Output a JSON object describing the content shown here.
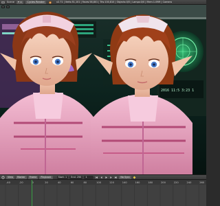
{
  "top_bar": {
    "editor_menu": "Scene",
    "render_engine": "Cycles Render",
    "stats": "v2.71 | Verts:51,101 | Faces:58,801 | Tris:100,810 | Objects:0/5 | Lamps:0/0 | Mem:1.09M | Camera"
  },
  "viewport": {
    "background_color": "#0d241f",
    "characters": [
      {
        "hair_color": "#9a3f1e",
        "suit_color": "#e8a4c0",
        "eye_color": "#4a7bc8",
        "ribbon_color": "#a46aca"
      },
      {
        "hair_color": "#a0401a",
        "suit_color": "#e8a4c0",
        "eye_color": "#4a7bc8",
        "ribbon_color": "#f0e4ec"
      }
    ],
    "console_readout": "2016 11:5 3:23 1"
  },
  "timeline_header": {
    "view_label": "View",
    "marker_label": "Marker",
    "frame_label": "Frame",
    "playback_label": "Playback",
    "start": "Start: 1",
    "end": "End: 250",
    "current_frame": "1",
    "sync": "No Sync"
  },
  "timeline": {
    "ticks": [
      "-40",
      "-20",
      "0",
      "20",
      "40",
      "60",
      "80",
      "100",
      "120",
      "140",
      "160",
      "180",
      "200",
      "220",
      "240",
      "260"
    ],
    "current_frame": 1
  },
  "colors": {
    "ui_dark": "#2b2b2b",
    "ui_panel": "#404040",
    "playhead": "#3fa84a"
  }
}
